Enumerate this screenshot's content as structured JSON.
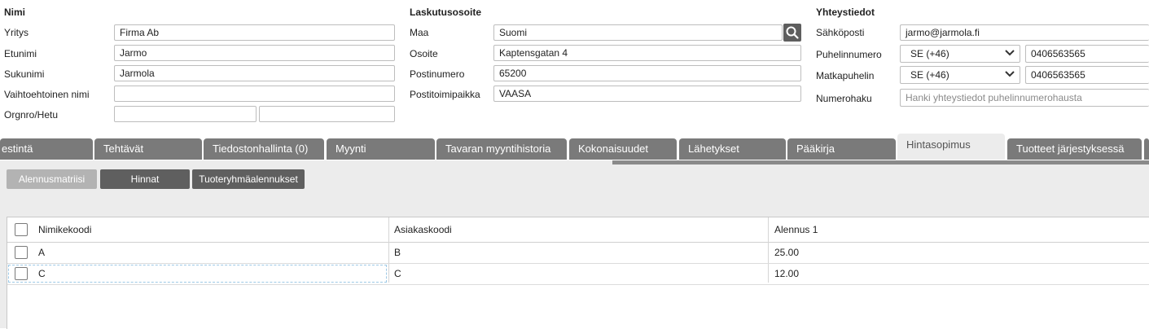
{
  "sections": {
    "name": {
      "title": "Nimi",
      "fields": [
        {
          "label": "Yritys",
          "value": "Firma Ab"
        },
        {
          "label": "Etunimi",
          "value": "Jarmo"
        },
        {
          "label": "Sukunimi",
          "value": "Jarmola"
        },
        {
          "label": "Vaihtoehtoinen nimi",
          "value": ""
        },
        {
          "label": "Orgnro/Hetu",
          "value": "",
          "value2": ""
        }
      ]
    },
    "billing": {
      "title": "Laskutusosoite",
      "fields": [
        {
          "label": "Maa",
          "value": "Suomi"
        },
        {
          "label": "Osoite",
          "value": "Kaptensgatan 4"
        },
        {
          "label": "Postinumero",
          "value": "65200"
        },
        {
          "label": "Postitoimipaikka",
          "value": "VAASA"
        }
      ]
    },
    "contact": {
      "title": "Yhteystiedot",
      "email": {
        "label": "Sähköposti",
        "value": "jarmo@jarmola.fi"
      },
      "phone": {
        "label": "Puhelinnumero",
        "country": "SE (+46)",
        "value": "0406563565"
      },
      "mobile": {
        "label": "Matkapuhelin",
        "country": "SE (+46)",
        "value": "0406563565"
      },
      "lookup": {
        "label": "Numerohaku",
        "placeholder": "Hanki yhteystiedot puhelinnumerohausta"
      }
    }
  },
  "tabs": [
    {
      "label": "estintä"
    },
    {
      "label": "Tehtävät"
    },
    {
      "label": "Tiedostonhallinta (0)"
    },
    {
      "label": "Myynti"
    },
    {
      "label": "Tavaran myyntihistoria"
    },
    {
      "label": "Kokonaisuudet"
    },
    {
      "label": "Lähetykset"
    },
    {
      "label": "Pääkirja"
    },
    {
      "label": "Hintasopimus",
      "active": true
    },
    {
      "label": "Tuotteet järjestyksessä"
    }
  ],
  "subtabs": [
    {
      "label": "Alennusmatriisi",
      "color": "#b3b3b3"
    },
    {
      "label": "Hinnat",
      "color": "#5f5f5f"
    },
    {
      "label": "Tuoteryhmäalennukset",
      "color": "#5f5f5f"
    }
  ],
  "table": {
    "columns": [
      "Nimikekoodi",
      "Asiakaskoodi",
      "Alennus 1"
    ],
    "rows": [
      [
        "A",
        "B",
        "25.00"
      ],
      [
        "C",
        "C",
        "12.00"
      ]
    ]
  },
  "icons": {
    "search": "search-icon",
    "chevron": "chevron-down-icon"
  }
}
